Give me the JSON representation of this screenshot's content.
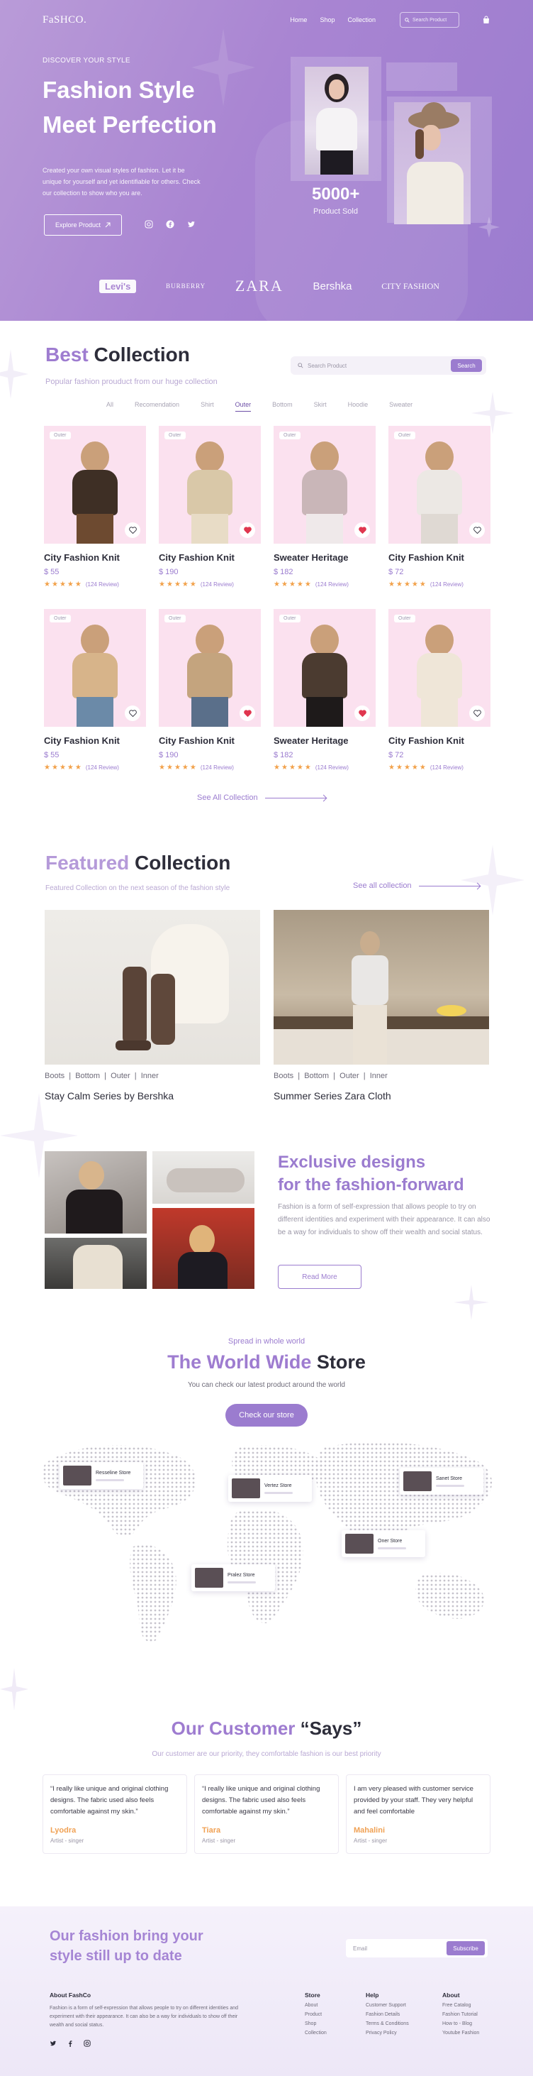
{
  "nav": {
    "logo": "FaSHCO.",
    "links": [
      "Home",
      "Shop",
      "Collection"
    ],
    "search_placeholder": "Search Product"
  },
  "hero": {
    "eyebrow": "DISCOVER YOUR STYLE",
    "title_line1": "Fashion Style",
    "title_line2": "Meet Perfection",
    "description": "Created your own visual styles of fashion. Let it be unique for yourself and yet identifiable for others. Check our collection to show who you are.",
    "cta": "Explore Product",
    "stat_value": "5000+",
    "stat_label": "Product Sold",
    "brands": [
      "Levi's",
      "BURBERRY",
      "ZARA",
      "Bershka",
      "CITY FASHION"
    ]
  },
  "best": {
    "title_accent": "Best",
    "title_rest": "Collection",
    "subtitle": "Popular fashion prouduct from our huge collection",
    "search_placeholder": "Search Product",
    "search_button": "Search",
    "filters": [
      "All",
      "Recomendation",
      "Shirt",
      "Outer",
      "Bottom",
      "Skirt",
      "Hoodie",
      "Sweater"
    ],
    "active_filter": "Outer",
    "products": [
      {
        "tag": "Outer",
        "name": "City Fashion Knit",
        "price": "$ 55",
        "reviews": "(124 Review)",
        "favorite": false
      },
      {
        "tag": "Outer",
        "name": "City Fashion Knit",
        "price": "$ 190",
        "reviews": "(124 Review)",
        "favorite": true
      },
      {
        "tag": "Outer",
        "name": "Sweater Heritage",
        "price": "$ 182",
        "reviews": "(124 Review)",
        "favorite": true
      },
      {
        "tag": "Outer",
        "name": "City Fashion Knit",
        "price": "$ 72",
        "reviews": "(124 Review)",
        "favorite": false
      },
      {
        "tag": "Outer",
        "name": "City Fashion Knit",
        "price": "$ 55",
        "reviews": "(124 Review)",
        "favorite": false
      },
      {
        "tag": "Outer",
        "name": "City Fashion Knit",
        "price": "$ 190",
        "reviews": "(124 Review)",
        "favorite": true
      },
      {
        "tag": "Outer",
        "name": "Sweater Heritage",
        "price": "$ 182",
        "reviews": "(124 Review)",
        "favorite": true
      },
      {
        "tag": "Outer",
        "name": "City Fashion Knit",
        "price": "$ 72",
        "reviews": "(124 Review)",
        "favorite": false
      }
    ],
    "see_all": "See All Collection"
  },
  "featured": {
    "title_accent": "Featured",
    "title_rest": "Collection",
    "subtitle": "Featured Collection on the next season of the fashion style",
    "see_all": "See all collection",
    "items": [
      {
        "tags": "Boots  |  Bottom  |  Outer  |  Inner",
        "name": "Stay Calm Series by Bershka"
      },
      {
        "tags": "Boots  |  Bottom  |  Outer  |  Inner",
        "name": "Summer Series Zara Cloth"
      }
    ]
  },
  "exclusive": {
    "title_line1": "Exclusive designs",
    "title_line2": "for the fashion-forward",
    "text": "Fashion is a form of self-expression that allows people to try on different identities and experiment with their appearance. It can also be a way for individuals to show off their wealth and social status.",
    "button": "Read More"
  },
  "store": {
    "eyebrow": "Spread in whole world",
    "title_accent": "The World Wide",
    "title_rest": "Store",
    "subtitle": "You can check our latest product around the world",
    "button": "Check our store",
    "stores": [
      "Resseline Store",
      "Vertez Store",
      "Sanet Store",
      "Oner Store",
      "Pralez Store"
    ]
  },
  "customers": {
    "title_accent": "Our Customer",
    "title_rest": "“Says”",
    "subtitle": "Our customer are our priority, they comfortable fashion is our best priority",
    "testimonials": [
      {
        "quote": "“I really like unique and original clothing designs. The fabric used also feels comfortable against my skin.”",
        "name": "Lyodra",
        "role": "Artist - singer"
      },
      {
        "quote": "“I really like unique and original clothing designs. The fabric used also feels comfortable against my skin.”",
        "name": "Tiara",
        "role": "Artist - singer"
      },
      {
        "quote": "I am very pleased with customer service provided by your staff. They very helpful and feel comfortable",
        "name": "Mahalini",
        "role": "Artist - singer"
      }
    ]
  },
  "footer": {
    "headline": "Our fashion bring your style still up to date",
    "email_placeholder": "Email",
    "subscribe": "Subscribe",
    "about_title": "About FashCo",
    "about_text": "Fashion is a form of self-expression that allows people to try on different identities and experiment with their appearance. It can also be a way for individuals to show off their wealth and social status.",
    "columns": [
      {
        "title": "Store",
        "items": [
          "About",
          "Product",
          "Shop",
          "Collection"
        ]
      },
      {
        "title": "Help",
        "items": [
          "Customer Support",
          "Fashion Details",
          "Terms & Conditions",
          "Privacy Policy"
        ]
      },
      {
        "title": "About",
        "items": [
          "Free Catalog",
          "Fashion Tutorial",
          "How to - Blog",
          "Youtube Fashion"
        ]
      }
    ]
  },
  "colors": {
    "accent": "#9b7ccf",
    "hero": "#a985d2",
    "star": "#f2a14a",
    "heart": "#e0364f",
    "card_bg": "#fbe1ef"
  }
}
